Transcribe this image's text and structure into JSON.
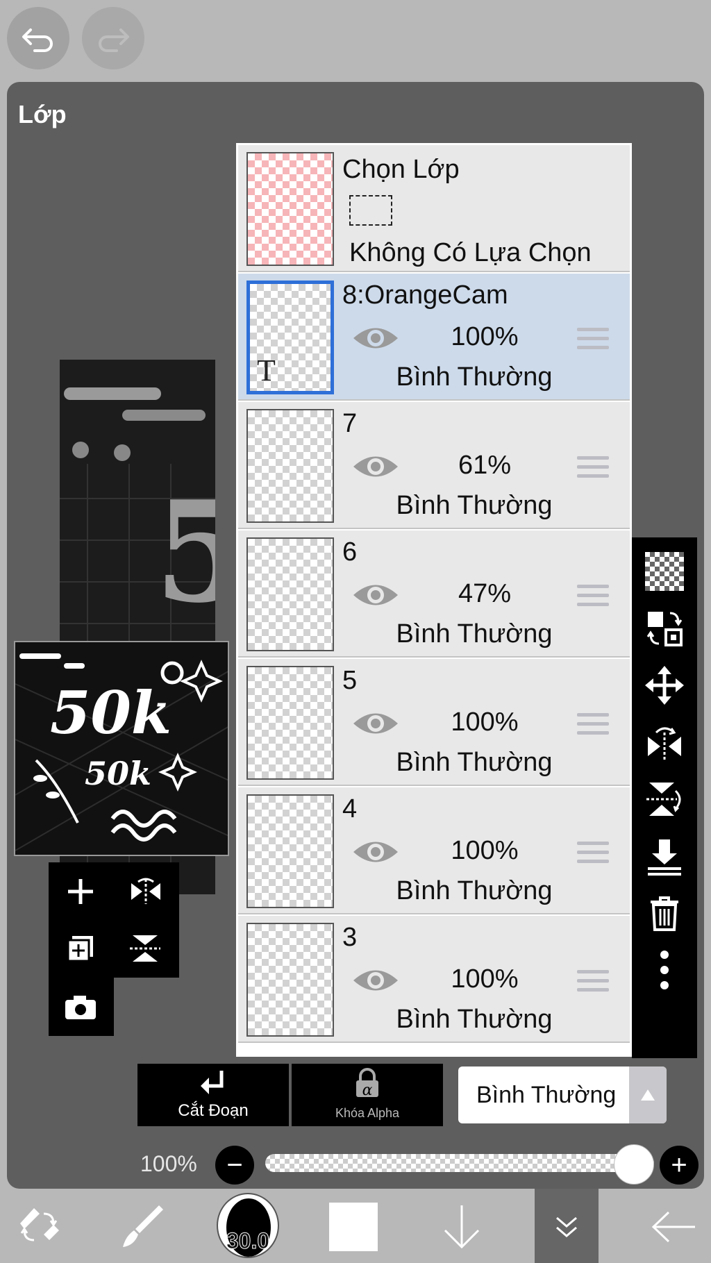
{
  "panel": {
    "title": "Lớp"
  },
  "selection_layer": {
    "title": "Chọn Lớp",
    "subtitle": "Không Có Lựa Chọn"
  },
  "layers": [
    {
      "name": "8:OrangeCam",
      "opacity": "100%",
      "blend": "Bình Thường",
      "selected": true,
      "is_text": true,
      "thumb_mark": "T"
    },
    {
      "name": "7",
      "opacity": "61%",
      "blend": "Bình Thường"
    },
    {
      "name": "6",
      "opacity": "47%",
      "blend": "Bình Thường"
    },
    {
      "name": "5",
      "opacity": "100%",
      "blend": "Bình Thường"
    },
    {
      "name": "4",
      "opacity": "100%",
      "blend": "Bình Thường"
    },
    {
      "name": "3",
      "opacity": "100%",
      "blend": "Bình Thường"
    }
  ],
  "controls": {
    "clipping_label": "Cắt Đoạn",
    "alpha_lock_label": "Khóa Alpha",
    "alpha_symbol": "α",
    "blend_mode": "Bình Thường",
    "opacity_label": "100%",
    "minus": "−",
    "plus": "+"
  },
  "toolbar": {
    "brush_size": "30.0"
  },
  "artwork": {
    "main_text": "50k",
    "sub_text": "50k",
    "big_digit": "5"
  },
  "colors": {
    "selected_row": "#cddaea",
    "selected_border": "#2e6fd8",
    "panel_bg": "#5e5e5e"
  }
}
